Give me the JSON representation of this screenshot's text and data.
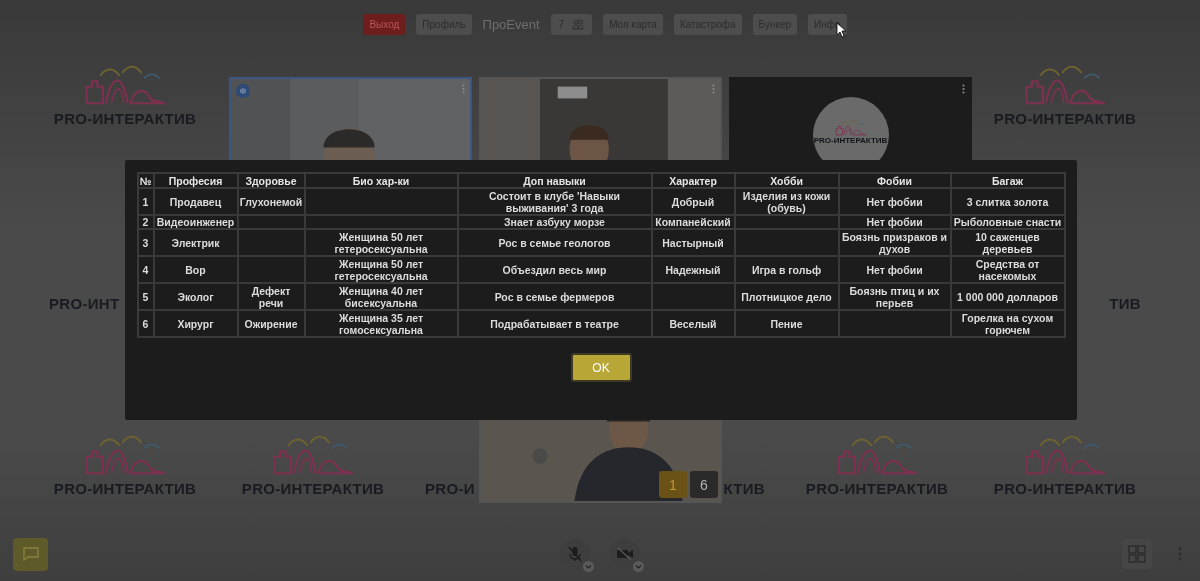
{
  "top_bar": {
    "items": [
      {
        "label": "Выход",
        "kind": "danger"
      },
      {
        "label": "Профиль",
        "kind": "button"
      },
      {
        "label": "ПроEvent",
        "kind": "brand"
      },
      {
        "label": "7",
        "kind": "participants"
      },
      {
        "label": "Моя карта",
        "kind": "button"
      },
      {
        "label": "Катастрофа",
        "kind": "button"
      },
      {
        "label": "Бункер",
        "kind": "button"
      },
      {
        "label": "Инфо",
        "kind": "button"
      }
    ]
  },
  "wallpaper": {
    "rows": [
      [
        {
          "kind": "logo",
          "title": "PRO-ИНТЕРАКТИВ"
        },
        {
          "kind": "hidden"
        },
        {
          "kind": "hidden"
        },
        {
          "kind": "hidden"
        },
        {
          "kind": "hidden"
        },
        {
          "kind": "logo",
          "title": "PRO-ИНТЕРАКТИВ"
        }
      ],
      [
        {
          "kind": "logo_start",
          "title": "PRO-ИНТ"
        },
        {
          "kind": "hidden"
        },
        {
          "kind": "hidden"
        },
        {
          "kind": "hidden"
        },
        {
          "kind": "hidden"
        },
        {
          "kind": "logo_end",
          "title": "ТИВ"
        }
      ],
      [
        {
          "kind": "logo",
          "title": "PRO-ИНТЕРАКТИВ"
        },
        {
          "kind": "logo",
          "title": "PRO-ИНТЕРАКТИВ"
        },
        {
          "kind": "logo_start",
          "title": "PRO-И"
        },
        {
          "kind": "logo_end",
          "title": "КТИВ"
        },
        {
          "kind": "logo",
          "title": "PRO-ИНТЕРАКТИВ"
        },
        {
          "kind": "logo",
          "title": "PRO-ИНТЕРАКТИВ"
        }
      ]
    ]
  },
  "video_tiles": [
    {
      "kind": "camera",
      "active": true
    },
    {
      "kind": "camera",
      "active": false
    },
    {
      "kind": "avatar",
      "active": false,
      "avatar_text": "PRO-ИНТЕРАКТИВ"
    },
    {
      "kind": "camera",
      "active": false,
      "pager": [
        {
          "label": "1",
          "selected": true
        },
        {
          "label": "6",
          "selected": false
        }
      ]
    }
  ],
  "dialog": {
    "table": {
      "columns": [
        "№",
        "Професия",
        "Здоровье",
        "Био хар-ки",
        "Доп навыки",
        "Характер",
        "Хобби",
        "Фобии",
        "Багаж"
      ],
      "rows": [
        [
          "1",
          "Продавец",
          "Глухонемой",
          "",
          "Состоит в клубе 'Навыки выживания' 3 года",
          "Добрый",
          "Изделия из кожи (обувь)",
          "Нет фобии",
          "3 слитка золота"
        ],
        [
          "2",
          "Видеоинженер",
          "",
          "",
          "Знает азбуку морзе",
          "Компанейский",
          "",
          "Нет фобии",
          "Рыболовные снасти"
        ],
        [
          "3",
          "Электрик",
          "",
          "Женщина 50 лет гетеросексуальна",
          "Рос в семье геологов",
          "Настырный",
          "",
          "Боязнь призраков и духов",
          "10 саженцев деревьев"
        ],
        [
          "4",
          "Вор",
          "",
          "Женщина 50 лет гетеросексуальна",
          "Объездил весь мир",
          "Надежный",
          "Игра в гольф",
          "Нет фобии",
          "Средства от насекомых"
        ],
        [
          "5",
          "Эколог",
          "Дефект речи",
          "Женщина 40 лет бисексуальна",
          "Рос в семье фермеров",
          "",
          "Плотницкое дело",
          "Боязнь птиц и их перьев",
          "1 000 000 долларов"
        ],
        [
          "6",
          "Хирург",
          "Ожирение",
          "Женщина 35 лет гомосексуальна",
          "Подрабатывает в театре",
          "Веселый",
          "Пение",
          "",
          "Горелка на сухом горючем"
        ]
      ]
    },
    "button": "OK"
  },
  "bottom_bar": {
    "mic_muted": true,
    "camera_off": true
  }
}
